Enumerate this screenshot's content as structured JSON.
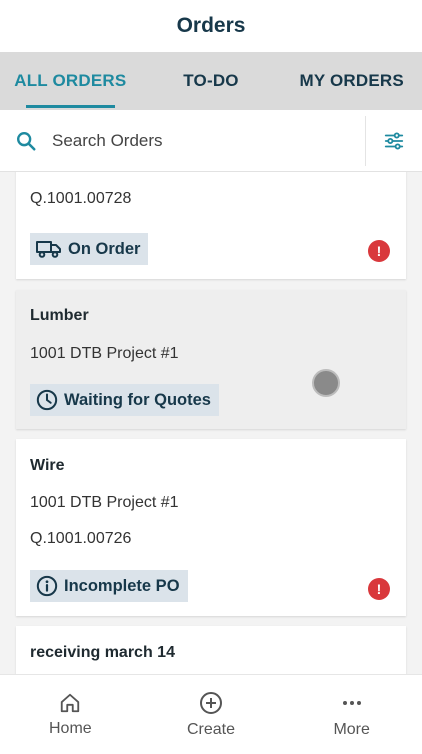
{
  "header": {
    "title": "Orders"
  },
  "tabs": [
    {
      "label": "ALL ORDERS",
      "active": true
    },
    {
      "label": "TO-DO",
      "active": false
    },
    {
      "label": "MY ORDERS",
      "active": false
    }
  ],
  "search": {
    "placeholder": "Search Orders"
  },
  "orders": [
    {
      "title": "",
      "line1": "Q.1001.00728",
      "status": "On Order",
      "status_icon": "truck-icon",
      "alert": true
    },
    {
      "title": "Lumber",
      "line1": "1001 DTB Project #1",
      "status": "Waiting for Quotes",
      "status_icon": "clock-icon",
      "alert": false
    },
    {
      "title": "Wire",
      "line1": "1001 DTB Project #1",
      "line2": "Q.1001.00726",
      "status": "Incomplete PO",
      "status_icon": "info-icon",
      "alert": true
    },
    {
      "title": "receiving march 14"
    }
  ],
  "bottom_nav": [
    {
      "label": "Home",
      "icon": "home-icon"
    },
    {
      "label": "Create",
      "icon": "plus-circle-icon"
    },
    {
      "label": "More",
      "icon": "more-icon"
    }
  ],
  "alert_glyph": "!",
  "colors": {
    "accent": "#1e8aa0",
    "navy": "#17384a",
    "badge_bg": "#dbe3ea",
    "alert": "#d9383c"
  }
}
